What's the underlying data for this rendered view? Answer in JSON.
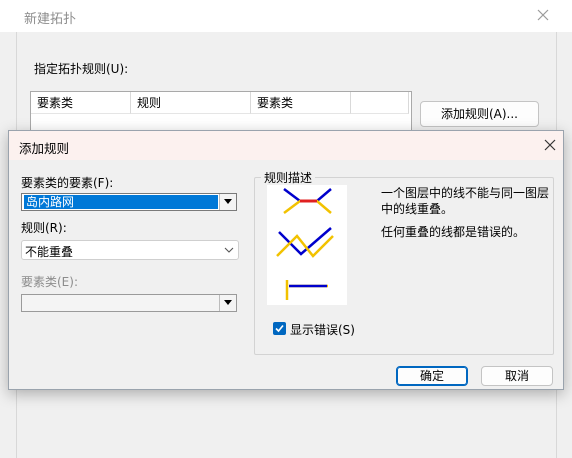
{
  "background_window": {
    "title": "新建拓扑",
    "spec_rules_label": "指定拓扑规则(U):",
    "table_headers": [
      "要素类",
      "规则",
      "要素类"
    ],
    "add_rule_button": "添加规则(A)..."
  },
  "dialog": {
    "title": "添加规则",
    "feature_of_class_label": "要素类的要素(F):",
    "feature_of_class_value": "岛内路网",
    "rule_label": "规则(R):",
    "rule_value": "不能重叠",
    "feature_class_label": "要素类(E):",
    "feature_class_value": "",
    "description_group": "规则描述",
    "description_1": "一个图层中的线不能与同一图层中的线重叠。",
    "description_2": "任何重叠的线都是错误的。",
    "show_errors_label": "显示错误(S)",
    "show_errors_checked": true,
    "ok_button": "确定",
    "cancel_button": "取消"
  },
  "icons": {
    "close": "close-icon",
    "dropdown": "chevron-down-icon",
    "checkmark": "checkmark-icon"
  },
  "colors": {
    "accent": "#0067c0",
    "selection": "#0078d7",
    "preview_line": "#0000cc",
    "preview_feature": "#f2c200",
    "preview_error": "#e02020"
  }
}
